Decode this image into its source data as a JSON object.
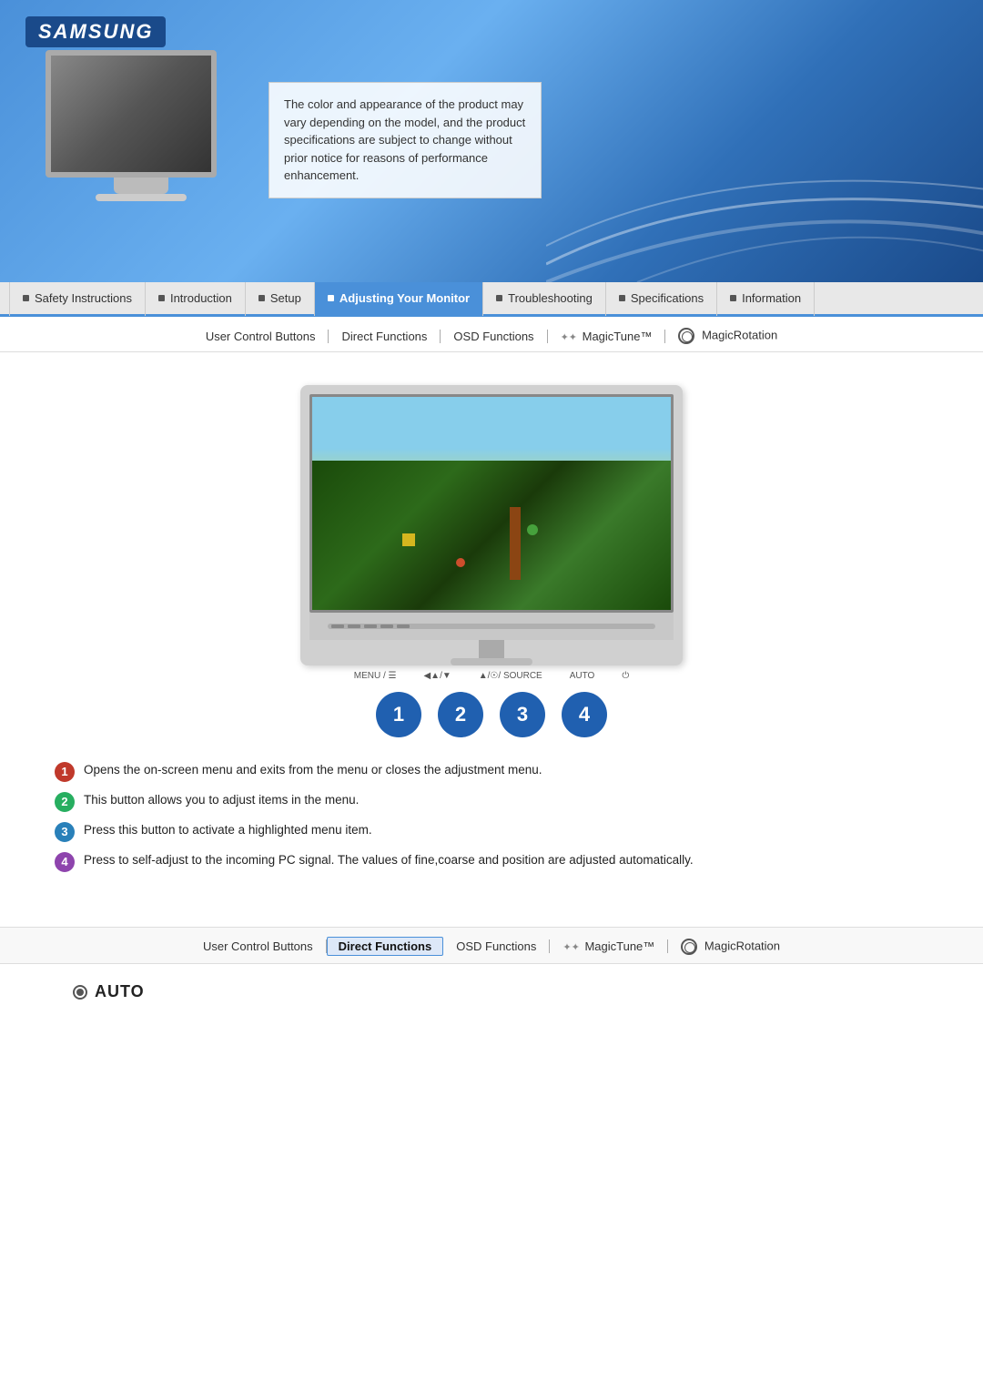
{
  "brand": "SAMSUNG",
  "header": {
    "banner_text": "The color and appearance of the product may vary depending on the model, and the product specifications are subject to change without prior notice for reasons of performance enhancement."
  },
  "nav_tabs": [
    {
      "label": "Safety Instructions",
      "active": false
    },
    {
      "label": "Introduction",
      "active": false
    },
    {
      "label": "Setup",
      "active": false
    },
    {
      "label": "Adjusting Your Monitor",
      "active": true
    },
    {
      "label": "Troubleshooting",
      "active": false
    },
    {
      "label": "Specifications",
      "active": false
    },
    {
      "label": "Information",
      "active": false
    }
  ],
  "sub_nav": {
    "items": [
      {
        "label": "User Control Buttons",
        "active": false,
        "highlight": false
      },
      {
        "label": "Direct Functions",
        "active": true,
        "highlight": false
      },
      {
        "label": "OSD Functions",
        "active": false,
        "highlight": false
      },
      {
        "label": "MagicTune™",
        "active": false,
        "highlight": false
      },
      {
        "label": "MagicRotation",
        "active": false,
        "highlight": false
      }
    ]
  },
  "control_labels": [
    "MENU / ☰☰☰",
    "◀▶/▼",
    "▲/◉",
    "⊙/ SOURCE",
    "AUTO",
    "⏻"
  ],
  "control_buttons": [
    {
      "number": "1",
      "color": "blue"
    },
    {
      "number": "2",
      "color": "blue"
    },
    {
      "number": "3",
      "color": "blue"
    },
    {
      "number": "4",
      "color": "blue"
    }
  ],
  "descriptions": [
    {
      "badge": "1",
      "text": "Opens the on-screen menu and exits from the menu or closes the adjustment menu."
    },
    {
      "badge": "2",
      "text": "This button allows you to adjust items in the menu."
    },
    {
      "badge": "3",
      "text": "Press this button to activate a highlighted menu item."
    },
    {
      "badge": "4",
      "text": "Press to self-adjust to the incoming PC signal. The values of fine,coarse and position are adjusted automatically."
    }
  ],
  "bottom_sub_nav": {
    "items": [
      {
        "label": "User Control Buttons",
        "active": false,
        "highlight": false
      },
      {
        "label": "Direct Functions",
        "active": true,
        "highlight": true
      },
      {
        "label": "OSD Functions",
        "active": false,
        "highlight": false
      },
      {
        "label": "MagicTune™",
        "active": false,
        "highlight": false
      },
      {
        "label": "MagicRotation",
        "active": false,
        "highlight": false
      }
    ]
  },
  "auto_section": {
    "label": "AUTO"
  }
}
